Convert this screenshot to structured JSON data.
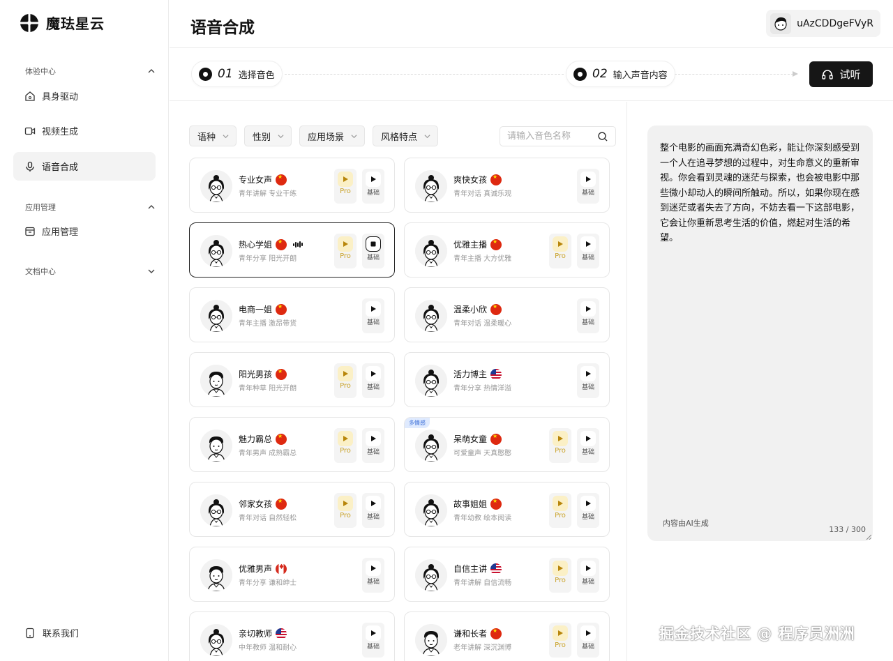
{
  "brand": {
    "name": "魔珐星云"
  },
  "sidebar": {
    "groups": [
      {
        "title": "体验中心",
        "items": [
          {
            "label": "具身驱动"
          },
          {
            "label": "视频生成"
          },
          {
            "label": "语音合成",
            "active": true
          }
        ]
      },
      {
        "title": "应用管理",
        "items": [
          {
            "label": "应用管理"
          }
        ]
      },
      {
        "title": "文档中心",
        "items": []
      }
    ],
    "contact": "联系我们"
  },
  "header": {
    "title": "语音合成",
    "user": "uAzCDDgeFVyR"
  },
  "steps": [
    {
      "num": "01",
      "label": "选择音色"
    },
    {
      "num": "02",
      "label": "输入声音内容"
    }
  ],
  "listen_button": "试听",
  "filters": [
    "语种",
    "性别",
    "应用场景",
    "风格特点"
  ],
  "search": {
    "placeholder": "请输入音色名称"
  },
  "voices": [
    {
      "name": "专业女声",
      "desc": "青年讲解 专业干练",
      "flag": "cn",
      "pro": true,
      "gender": "f"
    },
    {
      "name": "爽快女孩",
      "desc": "青年对话 真诚乐观",
      "flag": "cn",
      "pro": false,
      "gender": "f"
    },
    {
      "name": "热心学姐",
      "desc": "青年分享 阳光开朗",
      "flag": "cn",
      "pro": true,
      "gender": "f",
      "selected": true,
      "playing": true
    },
    {
      "name": "优雅主播",
      "desc": "青年主播 大方优雅",
      "flag": "cn",
      "pro": true,
      "gender": "f"
    },
    {
      "name": "电商一姐",
      "desc": "青年主播 激昂带货",
      "flag": "cn",
      "pro": false,
      "gender": "f"
    },
    {
      "name": "温柔小欣",
      "desc": "青年对话 温柔暖心",
      "flag": "cn",
      "pro": false,
      "gender": "f"
    },
    {
      "name": "阳光男孩",
      "desc": "青年种草 阳光开朗",
      "flag": "cn",
      "pro": true,
      "gender": "m"
    },
    {
      "name": "活力博主",
      "desc": "青年分享 热情洋溢",
      "flag": "us",
      "pro": false,
      "gender": "f"
    },
    {
      "name": "魅力霸总",
      "desc": "青年男声 成熟霸总",
      "flag": "cn",
      "pro": true,
      "gender": "m"
    },
    {
      "name": "呆萌女童",
      "desc": "可爱童声 天真憨憨",
      "flag": "cn",
      "pro": true,
      "gender": "f",
      "badge": "多情感"
    },
    {
      "name": "邻家女孩",
      "desc": "青年对话 自然轻松",
      "flag": "cn",
      "pro": true,
      "gender": "f"
    },
    {
      "name": "故事姐姐",
      "desc": "青年幼教 绘本阅读",
      "flag": "cn",
      "pro": true,
      "gender": "f"
    },
    {
      "name": "优雅男声",
      "desc": "青年分享 谦和绅士",
      "flag": "ca",
      "pro": false,
      "gender": "m"
    },
    {
      "name": "自信主讲",
      "desc": "青年讲解 自信流畅",
      "flag": "us",
      "pro": true,
      "gender": "f"
    },
    {
      "name": "亲切教师",
      "desc": "中年教师 温和耐心",
      "flag": "us",
      "pro": false,
      "gender": "f"
    },
    {
      "name": "谦和长者",
      "desc": "老年讲解 深沉渊博",
      "flag": "cn",
      "pro": true,
      "gender": "m"
    }
  ],
  "labels": {
    "pro": "Pro",
    "basic": "基础"
  },
  "text_panel": {
    "content": "整个电影的画面充满奇幻色彩，能让你深刻感受到一个人在追寻梦想的过程中，对生命意义的重新审视。你会看到灵魂的迷茫与探索，也会被电影中那些微小却动人的瞬间所触动。所以，如果你现在感到迷茫或者失去了方向，不妨去看一下这部电影，它会让你重新思考生活的价值，燃起对生活的希望。",
    "ai_note": "内容由AI生成",
    "count": "133 / 300"
  },
  "watermark": "掘金技术社区 @ 程序员洲洲"
}
